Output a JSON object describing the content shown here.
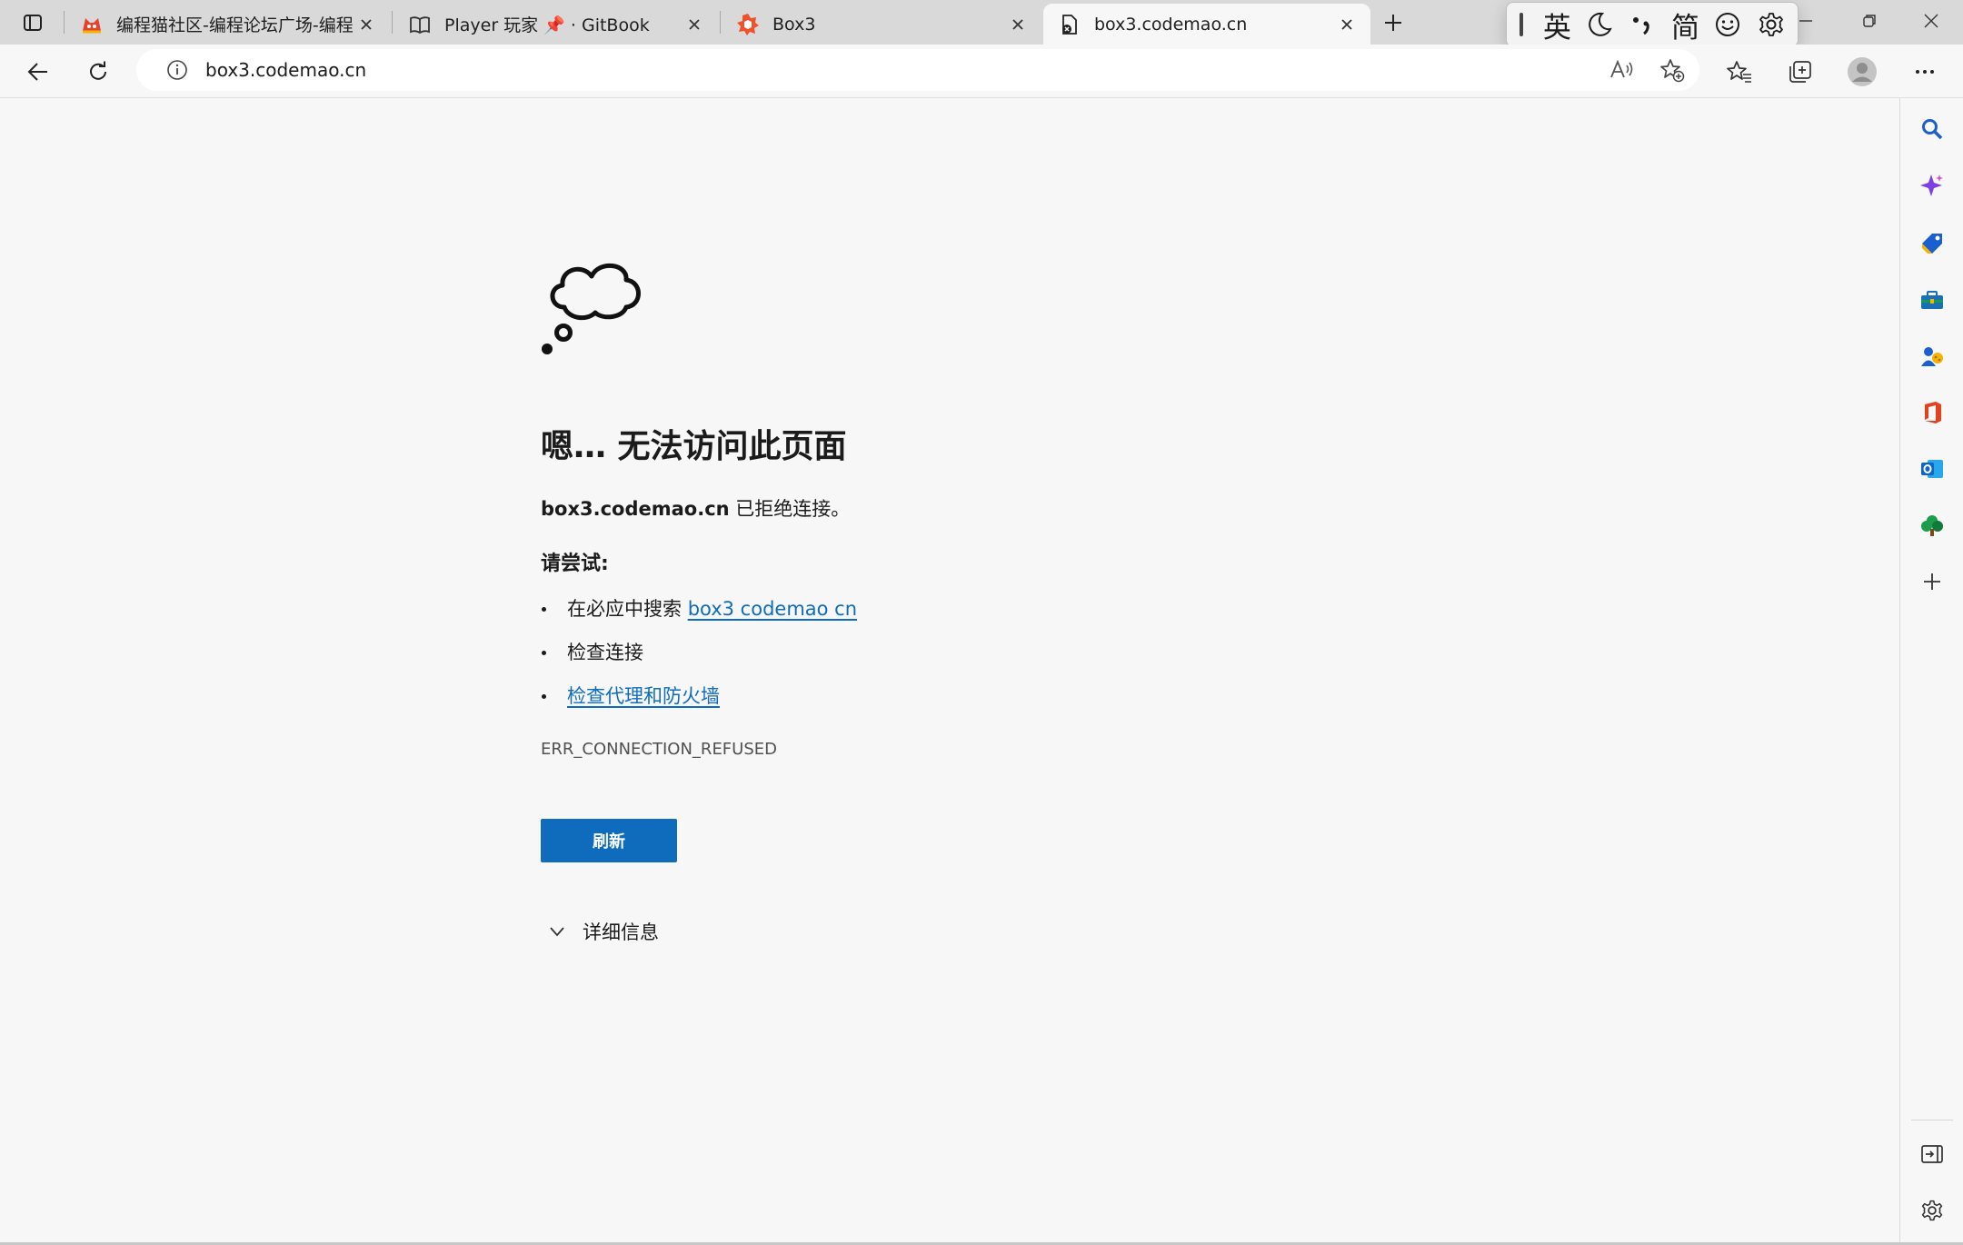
{
  "browser": {
    "tabs": [
      {
        "title": "编程猫社区-编程论坛广场-编程学",
        "favicon": "codemao-cat-icon",
        "active": false
      },
      {
        "title": "Player 玩家 📌 · GitBook",
        "favicon": "book-icon",
        "active": false
      },
      {
        "title": "Box3",
        "favicon": "box3-logo-icon",
        "active": false
      },
      {
        "title": "box3.codemao.cn",
        "favicon": "page-error-icon",
        "active": true
      }
    ],
    "address": {
      "url": "box3.codemao.cn"
    },
    "ime": {
      "lang": "英",
      "script": "简"
    }
  },
  "error_page": {
    "headline": "嗯… 无法访问此页面",
    "host": "box3.codemao.cn",
    "message": " 已拒绝连接。",
    "try_label": "请尝试:",
    "suggestions": {
      "search_prefix": "在必应中搜索 ",
      "search_link": "box3 codemao cn",
      "check_connection": "检查连接",
      "proxy_link": "检查代理和防火墙"
    },
    "error_code": "ERR_CONNECTION_REFUSED",
    "refresh_label": "刷新",
    "details_label": "详细信息"
  },
  "colors": {
    "accent": "#0f6cbd",
    "page_bg": "#f7f7f7",
    "tabstrip_bg": "#d9d9d9"
  }
}
